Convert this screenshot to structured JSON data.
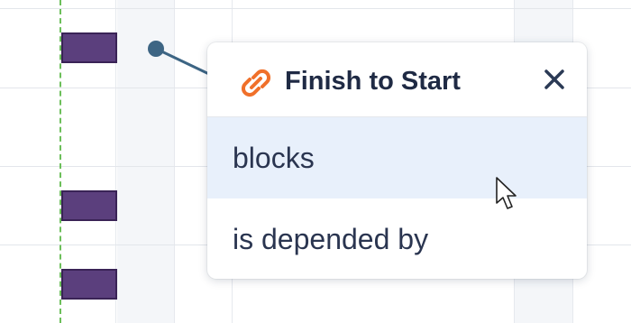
{
  "popup": {
    "title": "Finish to Start",
    "icon": "link-icon",
    "close_icon": "close-icon",
    "options": [
      {
        "label": "blocks",
        "state": "hovered"
      },
      {
        "label": "is depended by",
        "state": "default"
      }
    ]
  },
  "gantt": {
    "task_bar_count": 3,
    "today_marker_color": "#6cbf5a",
    "task_bar_color": "#5b3f7d",
    "connector_color": "#3d6584"
  },
  "colors": {
    "accent_icon": "#f0702a",
    "hover_background": "#e8f0fb",
    "text_primary": "#1f2a44"
  }
}
